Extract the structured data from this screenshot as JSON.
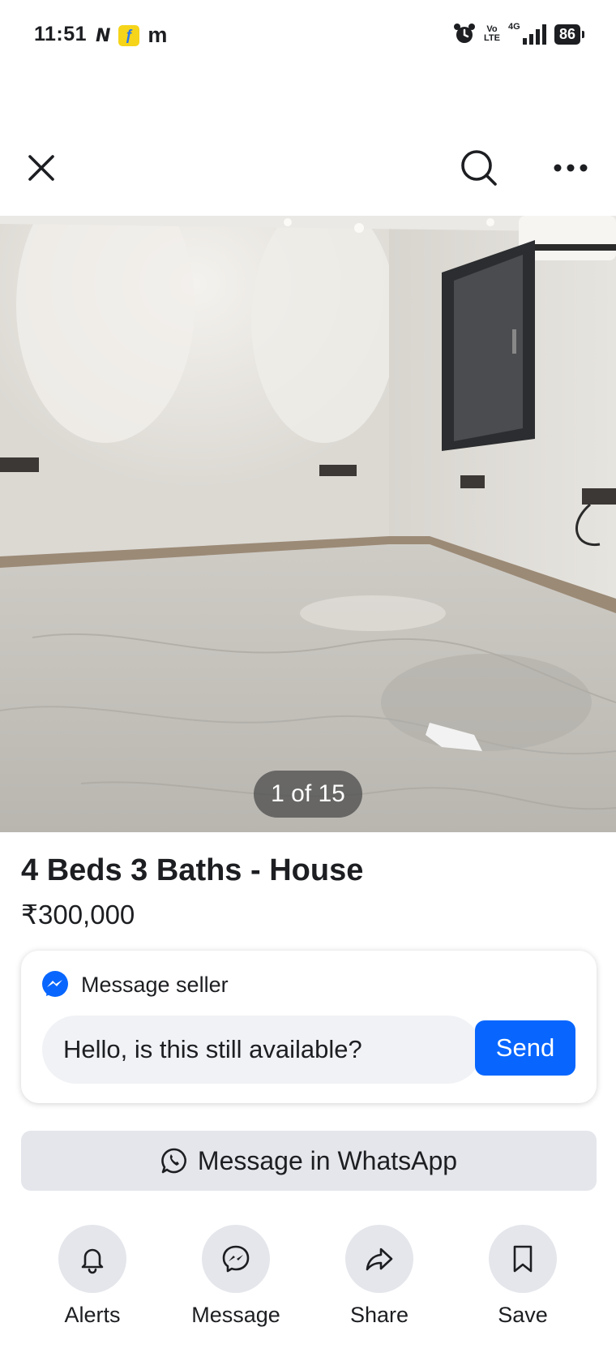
{
  "status_bar": {
    "time": "11:51",
    "notification_letter": "m",
    "volte_line1": "Vo",
    "volte_line2": "LTE",
    "network": "4G",
    "battery": "86"
  },
  "top_bar": {
    "close_icon": "close-icon",
    "search_icon": "search-icon",
    "more_icon": "more-horizontal-icon"
  },
  "photo": {
    "counter": "1 of 15"
  },
  "listing": {
    "title": "4 Beds 3 Baths - House",
    "price": "₹300,000"
  },
  "message_card": {
    "heading": "Message seller",
    "input_value": "Hello, is this still available?",
    "send_label": "Send"
  },
  "whatsapp": {
    "label": "Message in WhatsApp"
  },
  "actions": [
    {
      "label": "Alerts",
      "icon": "bell-icon"
    },
    {
      "label": "Message",
      "icon": "messenger-icon"
    },
    {
      "label": "Share",
      "icon": "share-icon"
    },
    {
      "label": "Save",
      "icon": "bookmark-icon"
    }
  ],
  "colors": {
    "accent": "#0866ff",
    "button_gray": "#e4e6eb",
    "input_gray": "#f0f2f5"
  }
}
